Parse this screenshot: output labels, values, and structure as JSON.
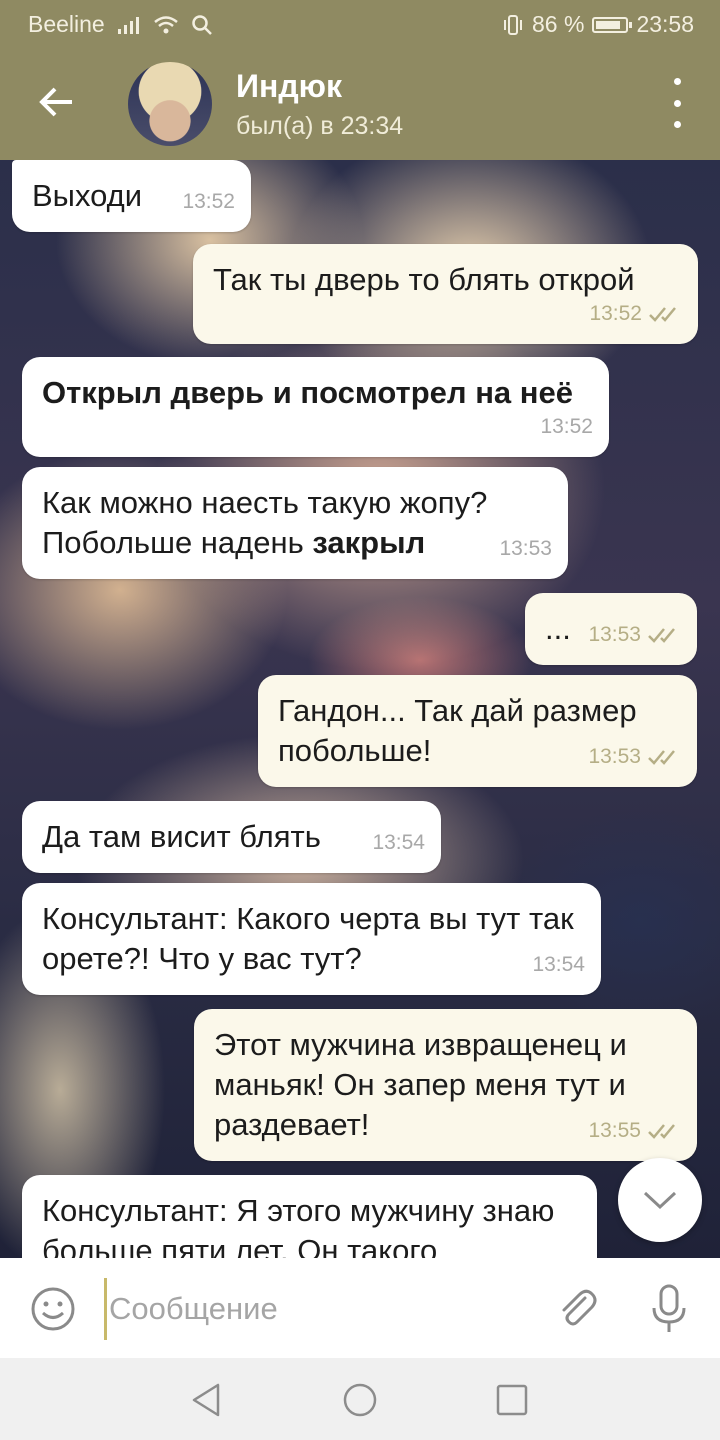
{
  "status_bar": {
    "carrier": "Beeline",
    "battery_percent": "86 %",
    "battery_level": 0.86,
    "time": "23:58"
  },
  "header": {
    "contact_name": "Индюк",
    "contact_status": "был(а) в 23:34"
  },
  "messages": [
    {
      "direction": "in",
      "text": "Выходи",
      "time": "13:52"
    },
    {
      "direction": "out",
      "text": "Так ты дверь то блять открой",
      "time": "13:52",
      "read": true
    },
    {
      "direction": "in",
      "text": "Открыл дверь и посмотрел на неё",
      "time": "13:52",
      "bold": true
    },
    {
      "direction": "in",
      "text": "Как можно наесть такую жопу? Побольше надень ",
      "bold_tail": "закрыл",
      "time": "13:53"
    },
    {
      "direction": "out",
      "text": "...",
      "time": "13:53",
      "read": true
    },
    {
      "direction": "out",
      "text": "Гандон... Так дай размер побольше!",
      "time": "13:53",
      "read": true
    },
    {
      "direction": "in",
      "text": "Да там висит блять",
      "time": "13:54"
    },
    {
      "direction": "in",
      "text": "Консультант: Какого черта вы тут так орете?! Что у вас тут?",
      "time": "13:54"
    },
    {
      "direction": "out",
      "text": "Этот мужчина извращенец и маньяк! Он запер меня тут и раздевает!",
      "time": "13:55",
      "read": true
    },
    {
      "direction": "in",
      "text": "Консультант: Я этого мужчину знаю больше пяти лет. Он такого",
      "time": ""
    }
  ],
  "input": {
    "placeholder": "Сообщение"
  },
  "colors": {
    "header": "#8f8a62",
    "incoming_bubble": "#ffffff",
    "outgoing_bubble": "#fbf8ea",
    "read_checks": "#b5ae86"
  },
  "icons": {
    "back": "arrow-left-icon",
    "menu": "more-vertical-icon",
    "read": "double-check-icon",
    "scroll_down": "chevron-down-icon",
    "emoji": "smile-icon",
    "attach": "paperclip-icon",
    "mic": "microphone-icon"
  }
}
